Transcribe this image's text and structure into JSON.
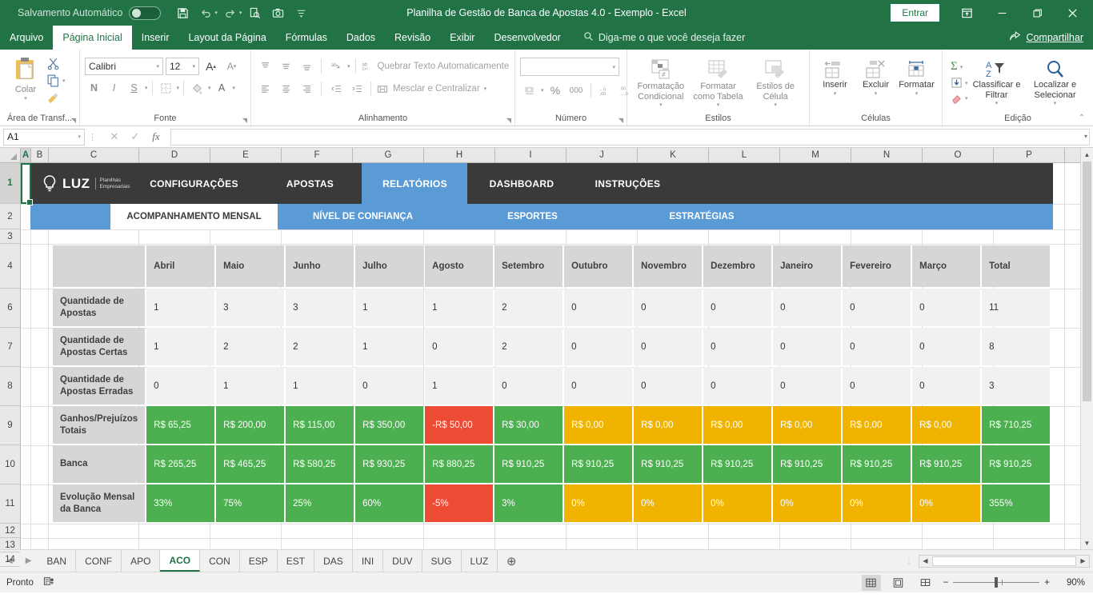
{
  "titlebar": {
    "autosave_label": "Salvamento Automático",
    "autosave_state": "off",
    "window_title": "Planilha de Gestão de Banca de Apostas 4.0 - Exemplo  -  Excel",
    "signin_label": "Entrar",
    "qat": [
      {
        "name": "save-icon",
        "glyph": "💾"
      },
      {
        "name": "undo-icon",
        "glyph": "↶"
      },
      {
        "name": "redo-icon",
        "glyph": "↷"
      },
      {
        "name": "print-preview-icon",
        "glyph": "🗋"
      },
      {
        "name": "camera-icon",
        "glyph": "📷"
      },
      {
        "name": "customize-qat-icon",
        "glyph": "⯆"
      }
    ],
    "window_controls": [
      {
        "name": "ribbon-display-options-icon",
        "glyph": "⬆"
      },
      {
        "name": "minimize-icon",
        "glyph": "─"
      },
      {
        "name": "restore-icon",
        "glyph": "❐"
      },
      {
        "name": "close-icon",
        "glyph": "✕"
      }
    ]
  },
  "menubar": {
    "tabs": [
      {
        "label": "Arquivo",
        "active": false
      },
      {
        "label": "Página Inicial",
        "active": true
      },
      {
        "label": "Inserir",
        "active": false
      },
      {
        "label": "Layout da Página",
        "active": false
      },
      {
        "label": "Fórmulas",
        "active": false
      },
      {
        "label": "Dados",
        "active": false
      },
      {
        "label": "Revisão",
        "active": false
      },
      {
        "label": "Exibir",
        "active": false
      },
      {
        "label": "Desenvolvedor",
        "active": false
      }
    ],
    "tellme_placeholder": "Diga-me o que você deseja fazer",
    "share_label": "Compartilhar"
  },
  "ribbon": {
    "clipboard": {
      "title": "Área de Transf...",
      "paste_label": "Colar",
      "cut_label": "Recortar",
      "copy_label": "Copiar",
      "format_painter_label": "Pincel de Formatação"
    },
    "font": {
      "title": "Fonte",
      "font_name": "Calibri",
      "font_size": "12",
      "grow_label": "A",
      "shrink_label": "A",
      "bold_label": "N",
      "italic_label": "I",
      "underline_label": "S",
      "borders_label": "Bordas",
      "fill_label": "Cor de Preenchimento",
      "fontcolor_label": "A"
    },
    "alignment": {
      "title": "Alinhamento",
      "wrap_label": "Quebrar Texto Automaticamente",
      "merge_label": "Mesclar e Centralizar"
    },
    "number": {
      "title": "Número",
      "format_value": "",
      "percent_label": "%",
      "thousands_label": "000"
    },
    "styles": {
      "title": "Estilos",
      "conditional_label": "Formatação Condicional",
      "table_label": "Formatar como Tabela",
      "cellstyles_label": "Estilos de Célula"
    },
    "cells": {
      "title": "Células",
      "insert_label": "Inserir",
      "delete_label": "Excluir",
      "format_label": "Formatar"
    },
    "editing": {
      "title": "Edição",
      "sort_label": "Classificar e Filtrar",
      "find_label": "Localizar e Selecionar"
    }
  },
  "formulabar": {
    "namebox_value": "A1",
    "cancel_icon": "✕",
    "enter_icon": "✓",
    "fx_label": "fx",
    "formula_value": ""
  },
  "grid": {
    "columns": [
      "A",
      "B",
      "C",
      "D",
      "E",
      "F",
      "G",
      "H",
      "I",
      "J",
      "K",
      "L",
      "M",
      "N",
      "O",
      "P"
    ],
    "selected_column": "A",
    "rows": [
      "1",
      "2",
      "3",
      "4",
      "6",
      "7",
      "8",
      "9",
      "10",
      "11",
      "12",
      "13",
      "14"
    ],
    "selected_row": "1"
  },
  "sheet_content": {
    "brand": {
      "name": "LUZ",
      "sub_line1": "Planilhas",
      "sub_line2": "Empresariais"
    },
    "nav": [
      {
        "label": "CONFIGURAÇÕES",
        "active": false
      },
      {
        "label": "APOSTAS",
        "active": false
      },
      {
        "label": "RELATÓRIOS",
        "active": true
      },
      {
        "label": "DASHBOARD",
        "active": false
      },
      {
        "label": "INSTRUÇÕES",
        "active": false
      }
    ],
    "subnav": [
      {
        "label": "ACOMPANHAMENTO MENSAL",
        "active": true
      },
      {
        "label": "NÍVEL DE CONFIANÇA",
        "active": false
      },
      {
        "label": "ESPORTES",
        "active": false
      },
      {
        "label": "ESTRATÉGIAS",
        "active": false
      }
    ]
  },
  "chart_data": {
    "type": "table",
    "title": "ACOMPANHAMENTO MENSAL",
    "categories": [
      "Abril",
      "Maio",
      "Junho",
      "Julho",
      "Agosto",
      "Setembro",
      "Outubro",
      "Novembro",
      "Dezembro",
      "Janeiro",
      "Fevereiro",
      "Março",
      "Total"
    ],
    "corner_header": "",
    "rows": [
      {
        "label": "Quantidade de Apostas",
        "values": [
          "1",
          "3",
          "3",
          "1",
          "1",
          "2",
          "0",
          "0",
          "0",
          "0",
          "0",
          "0",
          "11"
        ],
        "styles": [
          "plain",
          "plain",
          "plain",
          "plain",
          "plain",
          "plain",
          "plain",
          "plain",
          "plain",
          "plain",
          "plain",
          "plain",
          "plain"
        ]
      },
      {
        "label": "Quantidade de Apostas Certas",
        "values": [
          "1",
          "2",
          "2",
          "1",
          "0",
          "2",
          "0",
          "0",
          "0",
          "0",
          "0",
          "0",
          "8"
        ],
        "styles": [
          "plain",
          "plain",
          "plain",
          "plain",
          "plain",
          "plain",
          "plain",
          "plain",
          "plain",
          "plain",
          "plain",
          "plain",
          "plain"
        ]
      },
      {
        "label": "Quantidade de Apostas Erradas",
        "values": [
          "0",
          "1",
          "1",
          "0",
          "1",
          "0",
          "0",
          "0",
          "0",
          "0",
          "0",
          "0",
          "3"
        ],
        "styles": [
          "plain",
          "plain",
          "plain",
          "plain",
          "plain",
          "plain",
          "plain",
          "plain",
          "plain",
          "plain",
          "plain",
          "plain",
          "plain"
        ]
      },
      {
        "label": "Ganhos/Prejuízos Totais",
        "values": [
          "R$ 65,25",
          "R$ 200,00",
          "R$ 115,00",
          "R$ 350,00",
          "-R$ 50,00",
          "R$ 30,00",
          "R$ 0,00",
          "R$ 0,00",
          "R$ 0,00",
          "R$ 0,00",
          "R$ 0,00",
          "R$ 0,00",
          "R$ 710,25"
        ],
        "styles": [
          "green",
          "green",
          "green",
          "green",
          "red",
          "green",
          "amber",
          "amber",
          "amber",
          "amber",
          "amber",
          "amber",
          "green"
        ]
      },
      {
        "label": "Banca",
        "values": [
          "R$ 265,25",
          "R$ 465,25",
          "R$ 580,25",
          "R$ 930,25",
          "R$ 880,25",
          "R$ 910,25",
          "R$ 910,25",
          "R$ 910,25",
          "R$ 910,25",
          "R$ 910,25",
          "R$ 910,25",
          "R$ 910,25",
          "R$ 910,25"
        ],
        "styles": [
          "green",
          "green",
          "green",
          "green",
          "green",
          "green",
          "green",
          "green",
          "green",
          "green",
          "green",
          "green",
          "green"
        ]
      },
      {
        "label": "Evolução Mensal da Banca",
        "values": [
          "33%",
          "75%",
          "25%",
          "60%",
          "-5%",
          "3%",
          "0%",
          "0%",
          "0%",
          "0%",
          "0%",
          "0%",
          "355%"
        ],
        "styles": [
          "green",
          "green",
          "green",
          "green",
          "red",
          "green",
          "amber",
          "amber",
          "amber",
          "amber",
          "amber",
          "amber",
          "green"
        ]
      }
    ],
    "colors": {
      "green": "#4caf50",
      "red": "#ee4b35",
      "amber": "#f0b400",
      "header": "#d6d6d6",
      "plain": "#f1f1f1"
    }
  },
  "sheet_tabs": {
    "tabs": [
      {
        "label": "BAN",
        "active": false
      },
      {
        "label": "CONF",
        "active": false
      },
      {
        "label": "APO",
        "active": false
      },
      {
        "label": "ACO",
        "active": true
      },
      {
        "label": "CON",
        "active": false
      },
      {
        "label": "ESP",
        "active": false
      },
      {
        "label": "EST",
        "active": false
      },
      {
        "label": "DAS",
        "active": false
      },
      {
        "label": "INI",
        "active": false
      },
      {
        "label": "DUV",
        "active": false
      },
      {
        "label": "SUG",
        "active": false
      },
      {
        "label": "LUZ",
        "active": false
      }
    ],
    "add_label": "⊕"
  },
  "statusbar": {
    "status_text": "Pronto",
    "zoom_value": "90%",
    "zoom_minus": "−",
    "zoom_plus": "+",
    "views": [
      {
        "name": "normal-view-icon",
        "glyph": "▒",
        "active": true
      },
      {
        "name": "page-layout-view-icon",
        "glyph": "▣",
        "active": false
      },
      {
        "name": "page-break-view-icon",
        "glyph": "▥",
        "active": false
      }
    ]
  }
}
